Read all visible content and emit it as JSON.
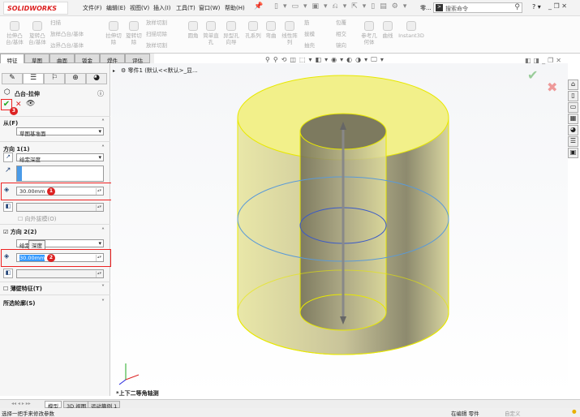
{
  "app": {
    "logo": "SOLIDWORKS",
    "menu": [
      "文件(F)",
      "编辑(E)",
      "视图(V)",
      "插入(I)",
      "工具(T)",
      "窗口(W)",
      "帮助(H)"
    ],
    "search_placeholder": "搜索命令",
    "right_label": "零..."
  },
  "ribbon": {
    "items": [
      {
        "label": "拉伸凸台/基体"
      },
      {
        "label": "旋转凸台/基体"
      },
      {
        "label": "扫描"
      },
      {
        "label": "放样凸台/基体"
      },
      {
        "label": "边界凸台/基体"
      },
      {
        "label": "拉伸切除"
      },
      {
        "label": "旋转切除"
      },
      {
        "label": "放样切割"
      },
      {
        "label": "扫描切除"
      },
      {
        "label": "放样切割"
      },
      {
        "label": "圆角"
      },
      {
        "label": "简单直孔"
      },
      {
        "label": "异型孔向导"
      },
      {
        "label": "孔系列"
      },
      {
        "label": "弯曲"
      },
      {
        "label": "线性阵列"
      },
      {
        "label": "筋"
      },
      {
        "label": "拔模"
      },
      {
        "label": "抽壳"
      },
      {
        "label": "包覆"
      },
      {
        "label": "相交"
      },
      {
        "label": "镜向"
      },
      {
        "label": "参考几何体"
      },
      {
        "label": "曲线"
      },
      {
        "label": "Instant3D"
      }
    ]
  },
  "tabs": [
    "特征",
    "草图",
    "曲面",
    "钣金",
    "焊件",
    "评估"
  ],
  "panel": {
    "title": "凸台-拉伸",
    "from_label": "从(F)",
    "from_value": "草图基准面",
    "dir1_label": "方向 1(1)",
    "dir1_type": "给定深度",
    "dir1_depth": "30.00mm",
    "draft_outward": "向外拔模(O)",
    "dir2_label": "方向 2(2)",
    "dir2_type": "给定深度",
    "dir2_tooltip": "深度",
    "dir2_depth": "30.00mm",
    "thin_feature": "薄壁特征(T)",
    "selected_contours": "所选轮廓(S)",
    "badges": [
      "1",
      "2",
      "3"
    ]
  },
  "viewport": {
    "tree_item": "零件1 (默认<<默认>_显...",
    "view_name": "*上下二等角轴测",
    "model_color": "#f2f08a",
    "edge_color": "#e8e800"
  },
  "bottom_tabs": [
    "模型",
    "3D 视图",
    "运动算例 1"
  ],
  "status": {
    "left": "选择一把手来修改参数",
    "mode": "在编辑 零件",
    "units": "自定义"
  }
}
